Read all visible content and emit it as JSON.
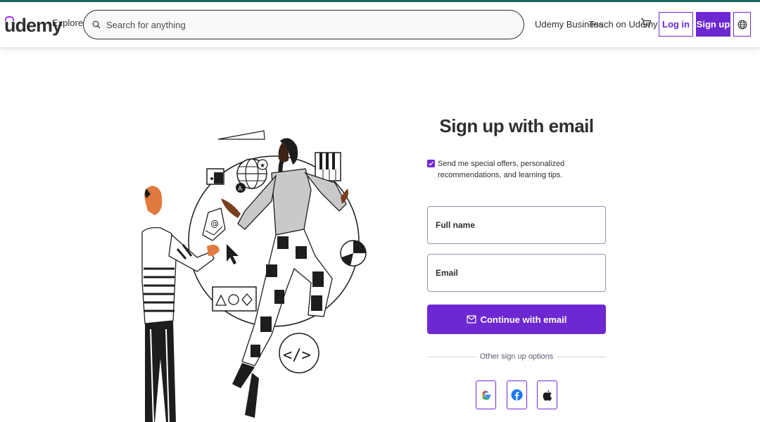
{
  "header": {
    "logo": "udemy",
    "explore": "Explore",
    "search": {
      "placeholder": "Search for anything"
    },
    "udemy_business": "Udemy Business",
    "teach": "Teach on Udemy",
    "login": "Log in",
    "signup": "Sign up",
    "icons": [
      "search-icon",
      "cart-icon",
      "globe-icon"
    ]
  },
  "form": {
    "title": "Sign up with email",
    "consent": {
      "checked": true,
      "text": "Send me special offers, personalized recommendations, and learning tips."
    },
    "full_name_label": "Full name",
    "email_label": "Email",
    "continue_label": "Continue with email",
    "other_options": "Other sign up options",
    "social": [
      "google",
      "facebook",
      "apple"
    ]
  },
  "colors": {
    "brand": "#6d28d2",
    "logo_accent": "#a435f0",
    "top_strip": "#1c6a5f",
    "text": "#2d2f31"
  }
}
